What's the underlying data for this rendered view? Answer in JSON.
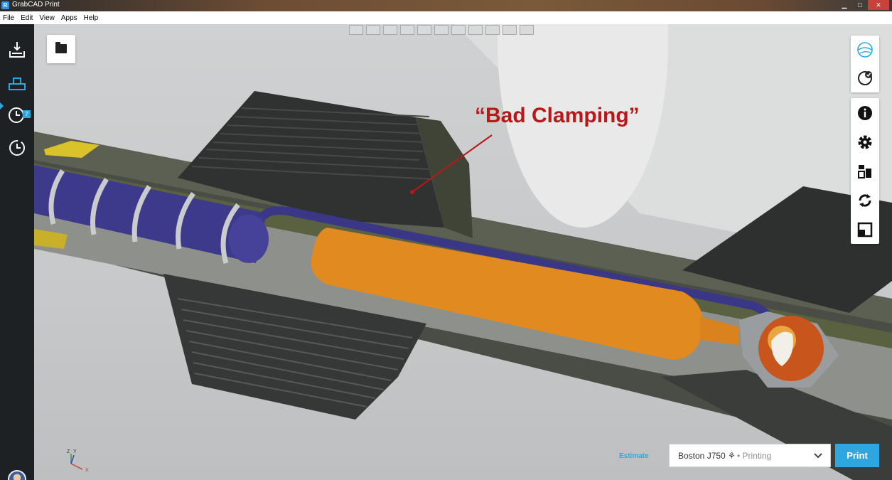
{
  "window": {
    "title": "GrabCAD Print",
    "app_icon": "R"
  },
  "menu": [
    "File",
    "Edit",
    "View",
    "Apps",
    "Help"
  ],
  "sidebar": {
    "items": [
      {
        "icon": "tray-import-icon",
        "active": false
      },
      {
        "icon": "model-workspace-icon",
        "active": true
      },
      {
        "icon": "clock-queue-icon",
        "badge": "7",
        "active": false
      },
      {
        "icon": "history-icon",
        "active": false
      }
    ]
  },
  "annotation": {
    "text": "“Bad Clamping”",
    "color": "#b81818"
  },
  "right_panel": {
    "top_group": [
      "globe-view-icon",
      "clock-check-icon"
    ],
    "tool_group": [
      "info-icon",
      "gear-icon",
      "arrange-icon",
      "rotate-icon",
      "scale-icon"
    ]
  },
  "footer": {
    "estimate_label": "Estimate",
    "printer_name": "Boston J750 ⚘",
    "printer_status": "• Printing",
    "print_label": "Print"
  },
  "axis_labels": {
    "x": "X",
    "y": "Y",
    "z": "Z"
  },
  "colors": {
    "accent": "#2ea7e0",
    "sidebar": "#1e2124",
    "annotation": "#b81818"
  }
}
